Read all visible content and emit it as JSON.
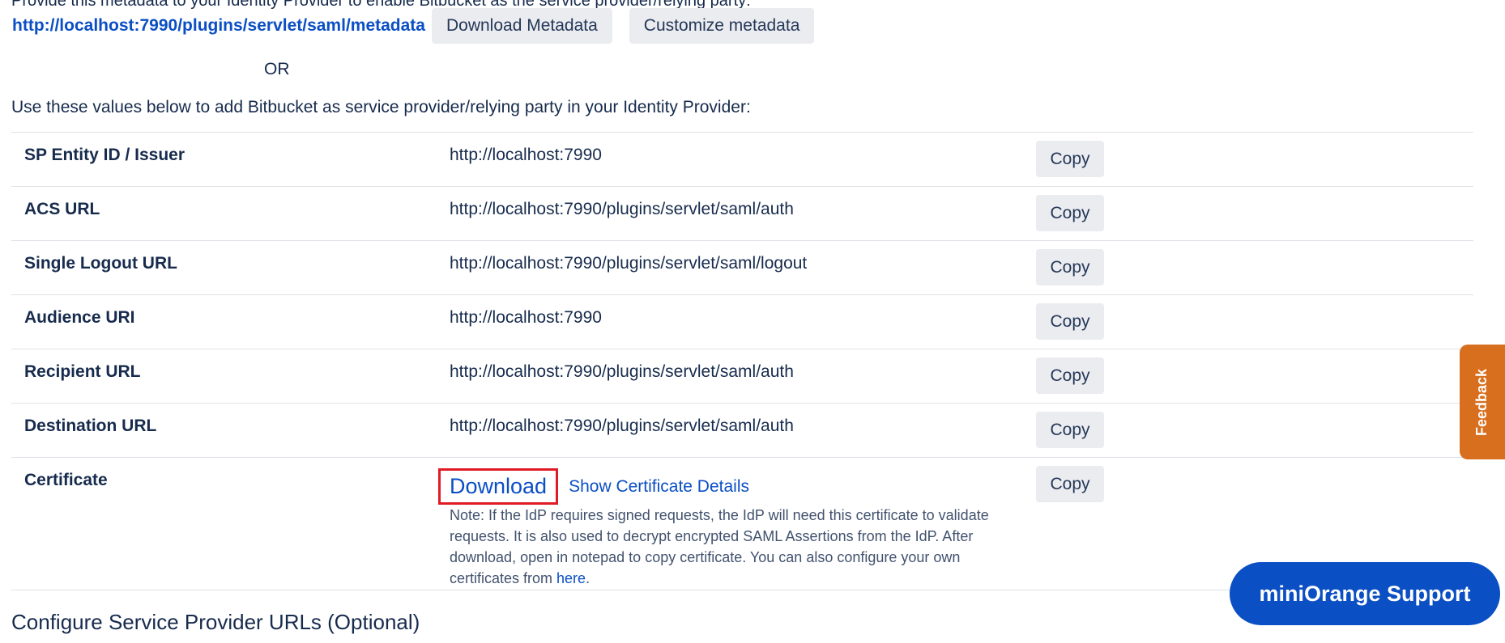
{
  "header": {
    "cut_text": "Provide this metadata to your Identity Provider to enable Bitbucket as the service provider/relying party:",
    "metadata_url": "http://localhost:7990/plugins/servlet/saml/metadata",
    "download_metadata_label": "Download Metadata",
    "customize_metadata_label": "Customize metadata",
    "or_label": "OR",
    "intro": "Use these values below to add Bitbucket as service provider/relying party in your Identity Provider:"
  },
  "rows": [
    {
      "label": "SP Entity ID / Issuer",
      "value": "http://localhost:7990",
      "copy": "Copy"
    },
    {
      "label": "ACS URL",
      "value": "http://localhost:7990/plugins/servlet/saml/auth",
      "copy": "Copy"
    },
    {
      "label": "Single Logout URL",
      "value": "http://localhost:7990/plugins/servlet/saml/logout",
      "copy": "Copy"
    },
    {
      "label": "Audience URI",
      "value": "http://localhost:7990",
      "copy": "Copy"
    },
    {
      "label": "Recipient URL",
      "value": "http://localhost:7990/plugins/servlet/saml/auth",
      "copy": "Copy"
    },
    {
      "label": "Destination URL",
      "value": "http://localhost:7990/plugins/servlet/saml/auth",
      "copy": "Copy"
    }
  ],
  "certificate": {
    "label": "Certificate",
    "download_label": "Download",
    "show_details_label": "Show Certificate Details",
    "copy": "Copy",
    "note_text": "Note: If the IdP requires signed requests, the IdP will need this certificate to validate requests. It is also used to decrypt encrypted SAML Assertions from the IdP. After download, open in notepad to copy certificate. You can also configure your own certificates from ",
    "note_link": "here",
    "note_end": "."
  },
  "section_title": "Configure Service Provider URLs (Optional)",
  "feedback_label": "Feedback",
  "support_label": "miniOrange Support",
  "colors": {
    "link": "#0b4fc4",
    "highlight_border": "#e01b24",
    "feedback_bg": "#d86f1e",
    "support_bg": "#0b4fc4"
  }
}
